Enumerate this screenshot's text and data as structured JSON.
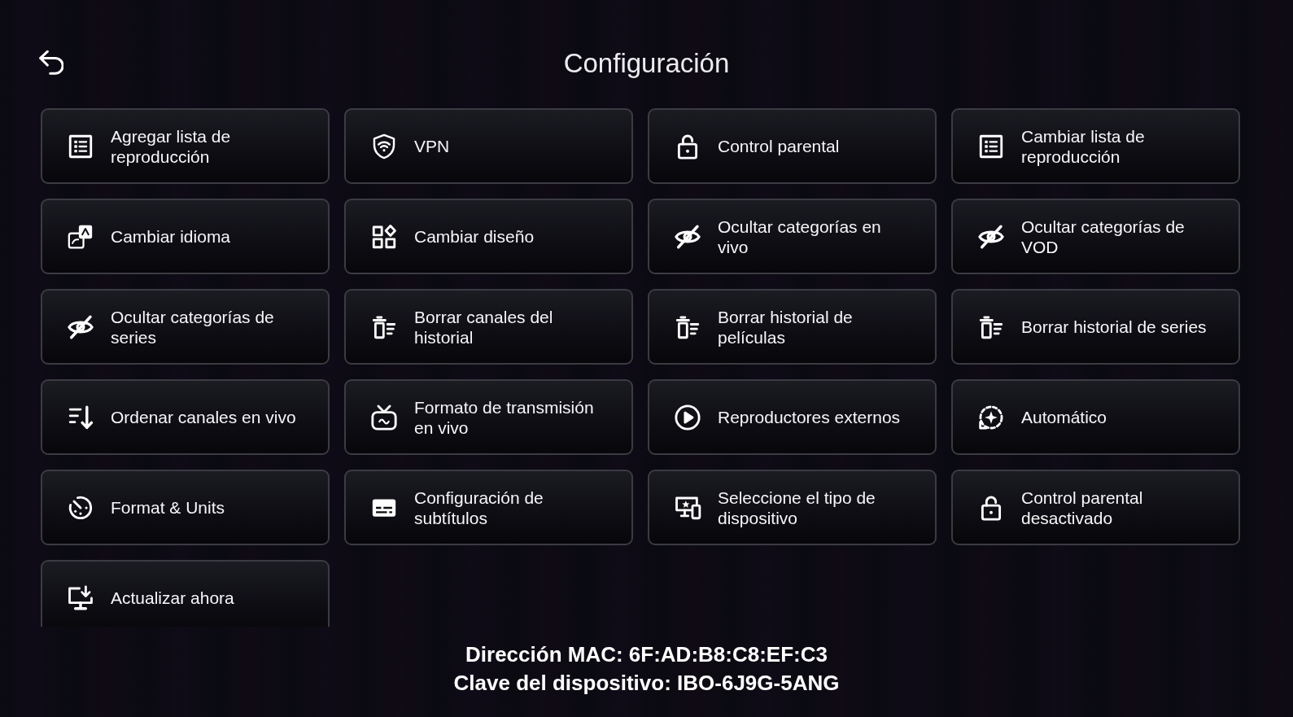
{
  "header": {
    "title": "Configuración"
  },
  "settings": [
    {
      "label": "Agregar lista de reproducción",
      "kind": "playlist"
    },
    {
      "label": "VPN",
      "kind": "vpn"
    },
    {
      "label": "Control parental",
      "kind": "lock"
    },
    {
      "label": "Cambiar lista de reproducción",
      "kind": "playlist"
    },
    {
      "label": "Cambiar idioma",
      "kind": "language"
    },
    {
      "label": "Cambiar diseño",
      "kind": "layout"
    },
    {
      "label": "Ocultar categorías en vivo",
      "kind": "hide"
    },
    {
      "label": "Ocultar categorías de VOD",
      "kind": "hide"
    },
    {
      "label": "Ocultar categorías de series",
      "kind": "hide"
    },
    {
      "label": "Borrar canales del historial",
      "kind": "clear"
    },
    {
      "label": "Borrar historial de películas",
      "kind": "clear"
    },
    {
      "label": "Borrar historial de series",
      "kind": "clear"
    },
    {
      "label": "Ordenar canales en vivo",
      "kind": "sort"
    },
    {
      "label": "Formato de transmisión en vivo",
      "kind": "stream"
    },
    {
      "label": "Reproductores externos",
      "kind": "player"
    },
    {
      "label": "Automático",
      "kind": "auto"
    },
    {
      "label": "Format & Units",
      "kind": "format"
    },
    {
      "label": "Configuración de subtítulos",
      "kind": "subtitles"
    },
    {
      "label": "Seleccione el tipo de dispositivo",
      "kind": "device"
    },
    {
      "label": "Control parental desactivado",
      "kind": "lock"
    },
    {
      "label": "Actualizar ahora",
      "kind": "update"
    }
  ],
  "footer": {
    "mac_address": "Dirección MAC: 6F:AD:B8:C8:EF:C3",
    "device_key": "Clave del dispositivo: IBO-6J9G-5ANG"
  }
}
